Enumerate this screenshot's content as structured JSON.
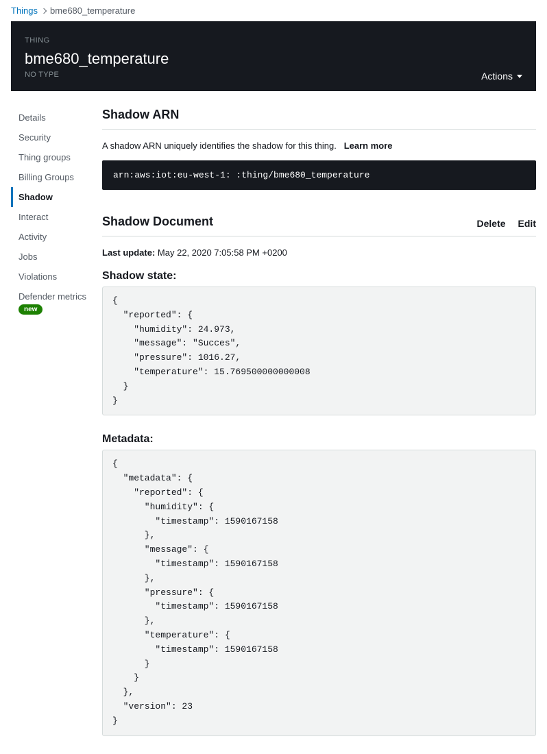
{
  "breadcrumb": {
    "root": "Things",
    "current": "bme680_temperature"
  },
  "header": {
    "label": "THING",
    "title": "bme680_temperature",
    "type": "NO TYPE",
    "actions_label": "Actions"
  },
  "sidebar": {
    "items": [
      {
        "label": "Details"
      },
      {
        "label": "Security"
      },
      {
        "label": "Thing groups"
      },
      {
        "label": "Billing Groups"
      },
      {
        "label": "Shadow",
        "active": true
      },
      {
        "label": "Interact"
      },
      {
        "label": "Activity"
      },
      {
        "label": "Jobs"
      },
      {
        "label": "Violations"
      },
      {
        "label": "Defender metrics",
        "badge": "new"
      }
    ]
  },
  "shadow_arn": {
    "title": "Shadow ARN",
    "desc": "A shadow ARN uniquely identifies the shadow for this thing.",
    "learn": "Learn more",
    "arn": "arn:aws:iot:eu-west-1:           :thing/bme680_temperature"
  },
  "shadow_doc": {
    "title": "Shadow Document",
    "delete": "Delete",
    "edit": "Edit",
    "last_update_label": "Last update:",
    "last_update_value": "May 22, 2020 7:05:58 PM +0200",
    "state_title": "Shadow state:",
    "state_code": "{\n  \"reported\": {\n    \"humidity\": 24.973,\n    \"message\": \"Succes\",\n    \"pressure\": 1016.27,\n    \"temperature\": 15.769500000000008\n  }\n}",
    "metadata_title": "Metadata:",
    "metadata_code": "{\n  \"metadata\": {\n    \"reported\": {\n      \"humidity\": {\n        \"timestamp\": 1590167158\n      },\n      \"message\": {\n        \"timestamp\": 1590167158\n      },\n      \"pressure\": {\n        \"timestamp\": 1590167158\n      },\n      \"temperature\": {\n        \"timestamp\": 1590167158\n      }\n    }\n  },\n  \"version\": 23\n}"
  }
}
